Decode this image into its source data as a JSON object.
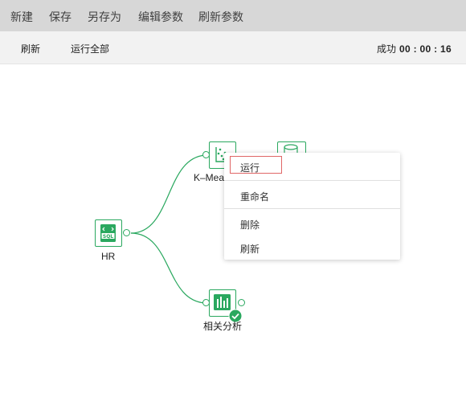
{
  "menu": {
    "new": "新建",
    "save": "保存",
    "save_as": "另存为",
    "edit_params": "编辑参数",
    "refresh_params": "刷新参数"
  },
  "toolbar": {
    "refresh": "刷新",
    "run_all": "运行全部",
    "status_label": "成功",
    "elapsed": "00 : 00 : 16"
  },
  "nodes": {
    "hr": {
      "label": "HR",
      "icon": "sql-icon"
    },
    "kmeans": {
      "label": "K–Mea",
      "icon": "scatter-plot-icon"
    },
    "storage": {
      "icon": "database-icon"
    },
    "correlation": {
      "label": "相关分析",
      "icon": "bar-chart-icon",
      "state": "success"
    }
  },
  "context_menu": {
    "run": "运行",
    "rename": "重命名",
    "delete": "删除",
    "refresh": "刷新"
  },
  "colors": {
    "accent": "#2aa85f",
    "menubar_bg": "#d7d7d7",
    "toolbar_bg": "#f2f2f2",
    "highlight_border": "#e06666"
  }
}
